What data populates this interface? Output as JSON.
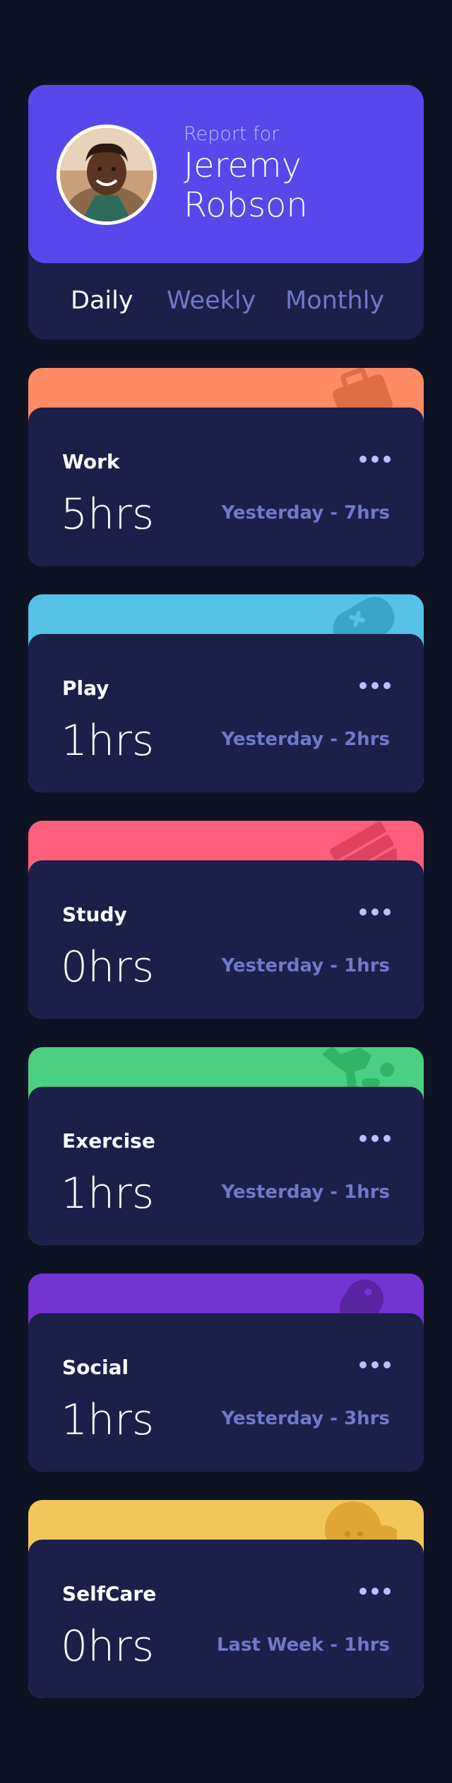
{
  "profile": {
    "report_label": "Report for",
    "name": "Jeremy Robson"
  },
  "tabs": [
    {
      "label": "Daily",
      "active": true
    },
    {
      "label": "Weekly",
      "active": false
    },
    {
      "label": "Monthly",
      "active": false
    }
  ],
  "activities": [
    {
      "title": "Work",
      "hours": "5hrs",
      "previous": "Yesterday - 7hrs",
      "color": "#ff8b64",
      "icon": "briefcase-icon"
    },
    {
      "title": "Play",
      "hours": "1hrs",
      "previous": "Yesterday - 2hrs",
      "color": "#55c2e6",
      "icon": "game-controller-icon"
    },
    {
      "title": "Study",
      "hours": "0hrs",
      "previous": "Yesterday - 1hrs",
      "color": "#ff5e7d",
      "icon": "book-icon"
    },
    {
      "title": "Exercise",
      "hours": "1hrs",
      "previous": "Yesterday - 1hrs",
      "color": "#4bcf82",
      "icon": "running-icon"
    },
    {
      "title": "Social",
      "hours": "1hrs",
      "previous": "Yesterday - 3hrs",
      "color": "#7335d2",
      "icon": "chat-bubble-icon"
    },
    {
      "title": "SelfCare",
      "hours": "0hrs",
      "previous": "Last Week - 1hrs",
      "color": "#f1c75b",
      "icon": "heart-icon"
    }
  ],
  "colors": {
    "background": "#0e1323",
    "card": "#1c1f4a",
    "accent": "#5847eb",
    "muted_text": "#7078c9"
  }
}
